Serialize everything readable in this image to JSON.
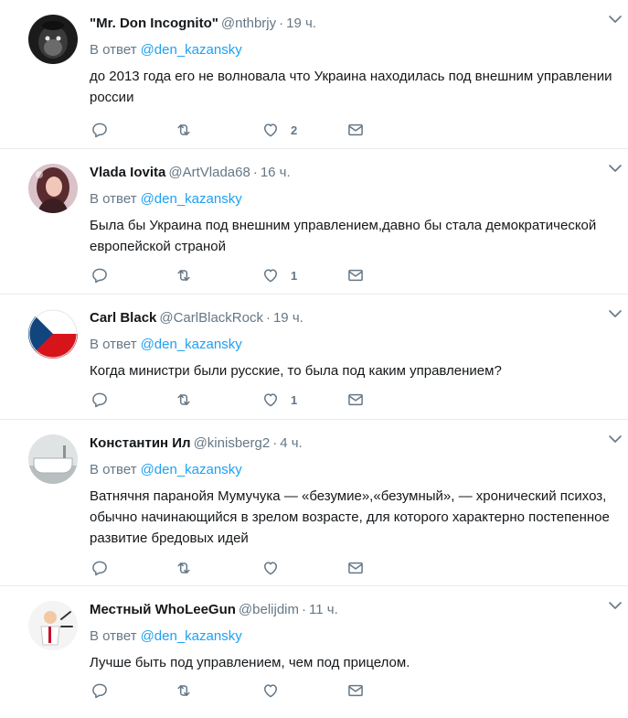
{
  "tweets": [
    {
      "name": "\"Mr. Don Incognito\"",
      "handle": "@nthbrjy",
      "dot": "·",
      "time": "19 ч.",
      "reply_prefix": "В ответ",
      "reply_to": "@den_kazansky",
      "text": "до 2013 года его не волновала что Украина находилась под внешним управлении россии",
      "likes": "2",
      "avatar": "monkey-avatar"
    },
    {
      "name": "Vlada Iovita",
      "handle": "@ArtVlada68",
      "dot": "·",
      "time": "16 ч.",
      "reply_prefix": "В ответ",
      "reply_to": "@den_kazansky",
      "text": "Была бы Украина под внешним управлением,давно бы стала демократической европейской страной",
      "likes": "1",
      "avatar": "woman-avatar"
    },
    {
      "name": "Carl Black",
      "handle": "@CarlBlackRock",
      "dot": "·",
      "time": "19 ч.",
      "reply_prefix": "В ответ",
      "reply_to": "@den_kazansky",
      "text": "Когда министри были русские, то была под каким управлением?",
      "likes": "1",
      "avatar": "czech-flag-avatar"
    },
    {
      "name": "Константин Ил",
      "handle": "@kinisberg2",
      "dot": "·",
      "time": "4 ч.",
      "reply_prefix": "В ответ",
      "reply_to": "@den_kazansky",
      "text": "Ватнячня паранойя Мумучука — «безумие»,«безумный», — хронический психоз, обычно начинающийся в зрелом возрасте, для которого характерно постепенное развитие бредовых идей",
      "likes": "",
      "avatar": "bathtub-avatar"
    },
    {
      "name": "Местный WhoLeeGun",
      "handle": "@belijdim",
      "dot": "·",
      "time": "11 ч.",
      "reply_prefix": "В ответ",
      "reply_to": "@den_kazansky",
      "text": "Лучше быть под управлением, чем под прицелом.",
      "likes": "",
      "avatar": "cartoon-man-avatar"
    }
  ],
  "colors": {
    "link": "#1da1f2",
    "muted": "#657786",
    "text": "#14171a",
    "border": "#e6ecf0"
  }
}
